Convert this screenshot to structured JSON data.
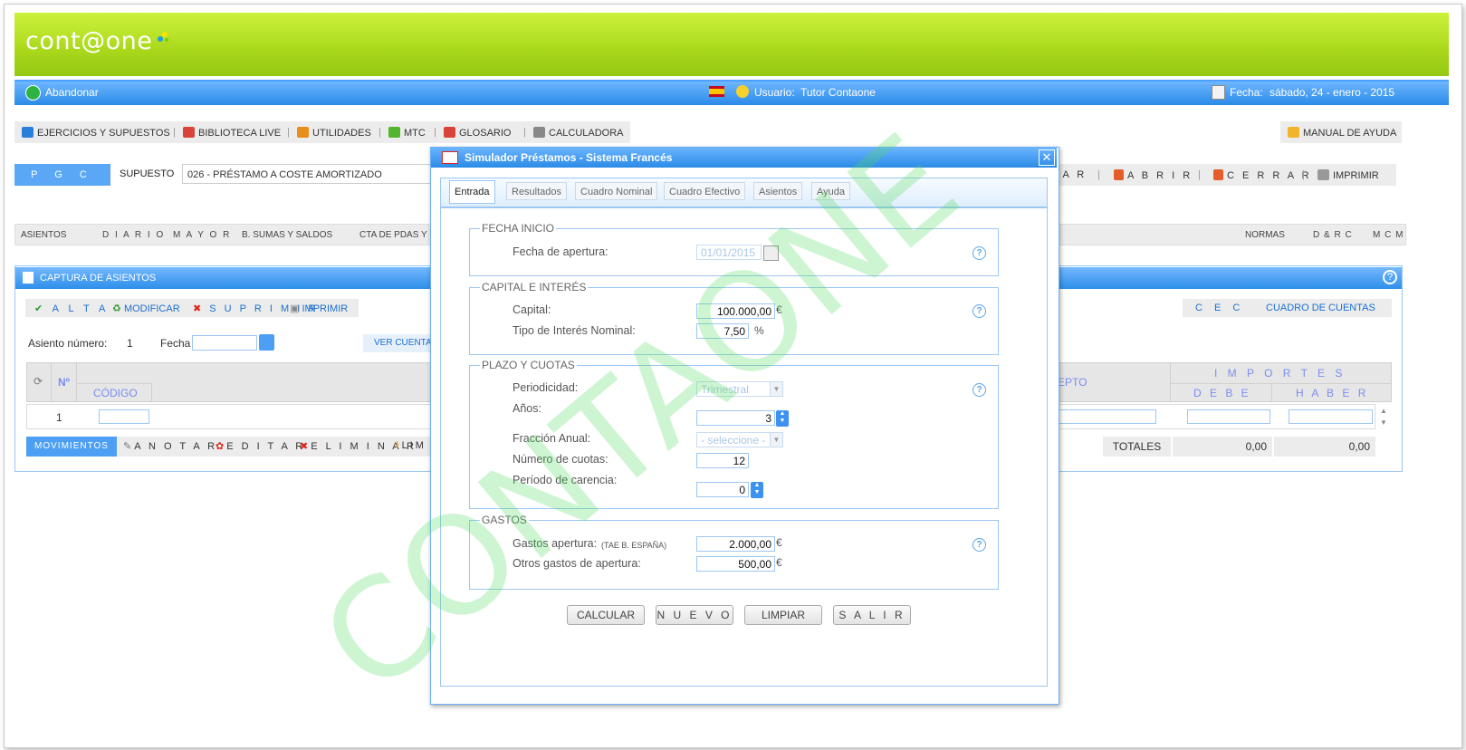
{
  "app": {
    "logo": "cont@one",
    "abandon_label": "Abandonar",
    "user_label": "Usuario:",
    "user_name": "Tutor Contaone",
    "date_label": "Fecha:",
    "date_value": "sábado, 24 - enero - 2015"
  },
  "menu": {
    "items": [
      "EJERCICIOS Y SUPUESTOS",
      "BIBLIOTECA LIVE",
      "UTILIDADES",
      "MTC",
      "GLOSARIO",
      "CALCULADORA"
    ],
    "help": "MANUAL DE AYUDA"
  },
  "pgc": {
    "label": "P G C",
    "supuesto_label": "SUPUESTO",
    "supuesto_value": "026 - PRÉSTAMO A COSTE AMORTIZADO",
    "right_actions": [
      "I A R",
      "A B R I R",
      "C E R R A R",
      "IMPRIMIR"
    ]
  },
  "tabsrow": {
    "left": [
      "ASIENTOS",
      "D I A R I O",
      "M A Y O R",
      "B. SUMAS Y SALDOS",
      "CTA DE PDAS Y"
    ],
    "right": [
      "NORMAS",
      "D & R C",
      "M C M"
    ]
  },
  "captura": {
    "title": "CAPTURA DE ASIENTOS",
    "actions": [
      "A L T A",
      "MODIFICAR",
      "S U P R I M I R",
      "IMPRIMIR"
    ],
    "right_actions": [
      "C E C",
      "CUADRO DE CUENTAS"
    ],
    "asiento_label": "Asiento número:",
    "asiento_value": "1",
    "fecha_label": "Fecha",
    "ver_cuentas": "VER CUENTA",
    "col_no": "Nº",
    "col_codigo": "CÓDIGO",
    "col_concepto": "EPTO",
    "col_importes": "I M P O R T E S",
    "col_debe": "D E B E",
    "col_haber": "H A B E R",
    "row_number": "1",
    "footer_actions": [
      "MOVIMIENTOS",
      "A N O T A R",
      "E D I T A R",
      "E L I M I N A R",
      "LIM"
    ],
    "totals_label": "TOTALES",
    "total_debe": "0,00",
    "total_haber": "0,00"
  },
  "dialog": {
    "title": "Simulador Préstamos - Sistema Francés",
    "tabs": [
      "Entrada",
      "Resultados",
      "Cuadro Nominal",
      "Cuadro Efectivo",
      "Asientos",
      "Ayuda"
    ],
    "fecha_inicio": {
      "legend": "FECHA INICIO",
      "apertura_label": "Fecha de apertura:",
      "apertura_value": "01/01/2015"
    },
    "capital_interes": {
      "legend": "CAPITAL E INTERÉS",
      "capital_label": "Capital:",
      "capital_value": "100.000,00",
      "capital_unit": "€",
      "tipo_label": "Tipo de Interés Nominal:",
      "tipo_value": "7,50",
      "tipo_unit": "%"
    },
    "plazo": {
      "legend": "PLAZO Y CUOTAS",
      "periodicidad_label": "Periodicidad:",
      "periodicidad_value": "Trimestral",
      "anos_label": "Años:",
      "anos_value": "3",
      "fraccion_label": "Fracción Anual:",
      "fraccion_value": "- seleccione -",
      "cuotas_label": "Número de cuotas:",
      "cuotas_value": "12",
      "carencia_label": "Período de carencia:",
      "carencia_value": "0"
    },
    "gastos": {
      "legend": "GASTOS",
      "apertura_label": "Gastos apertura:",
      "apertura_note": "(TAE B. ESPAÑA)",
      "apertura_value": "2.000,00",
      "otros_label": "Otros gastos de apertura:",
      "otros_value": "500,00",
      "unit": "€"
    },
    "buttons": [
      "CALCULAR",
      "N U E V O",
      "LIMPIAR",
      "S A L I R"
    ],
    "watermark": "CONTAONE"
  },
  "colors": {
    "header_green": "#a9d81b",
    "bar_blue": "#2a8be8",
    "link_blue": "#1b6fd1"
  }
}
